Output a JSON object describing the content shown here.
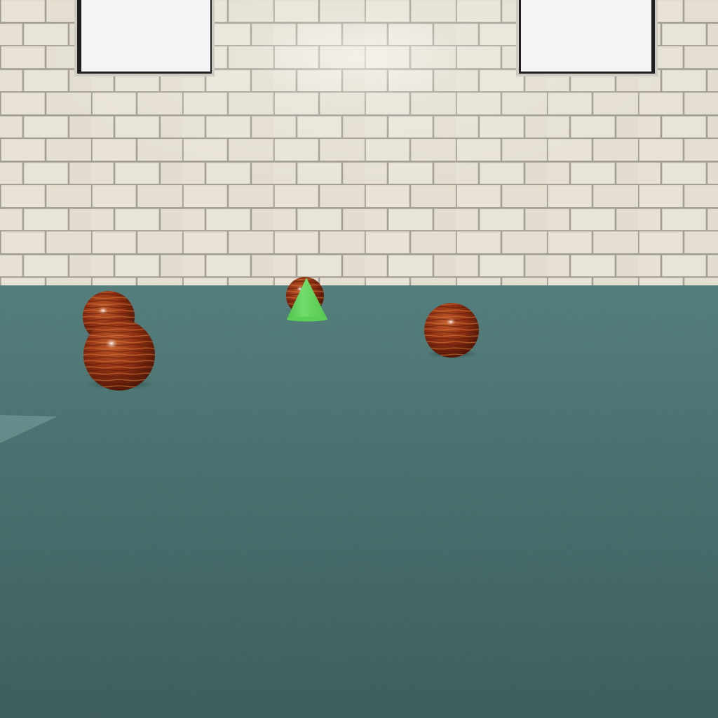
{
  "scene": {
    "type": "3d-room",
    "wall": {
      "material": "white-brick-tile",
      "base_color": "#e3ddcf",
      "mortar_color": "#9e9a90"
    },
    "floor": {
      "material": "teal-carpet",
      "near_color": "#3a5a59",
      "far_color": "#4f7a78"
    },
    "windows": [
      {
        "name": "window-left",
        "glass_color": "#f4f4f4",
        "frame_color": "#2a2a2a"
      },
      {
        "name": "window-right",
        "glass_color": "#f4f4f4",
        "frame_color": "#2a2a2a"
      }
    ],
    "objects": [
      {
        "name": "wooden-sphere-back-left",
        "shape": "sphere",
        "material": "wood",
        "color": "#8a2a10"
      },
      {
        "name": "wooden-sphere-front-left",
        "shape": "sphere",
        "material": "wood",
        "color": "#8a2a10"
      },
      {
        "name": "wooden-sphere-center-back",
        "shape": "sphere",
        "material": "wood",
        "color": "#8a2a10"
      },
      {
        "name": "wooden-sphere-right",
        "shape": "sphere",
        "material": "wood",
        "color": "#8a2a10"
      },
      {
        "name": "green-cone",
        "shape": "cone",
        "material": "plastic",
        "color": "#5fd35a"
      }
    ]
  }
}
